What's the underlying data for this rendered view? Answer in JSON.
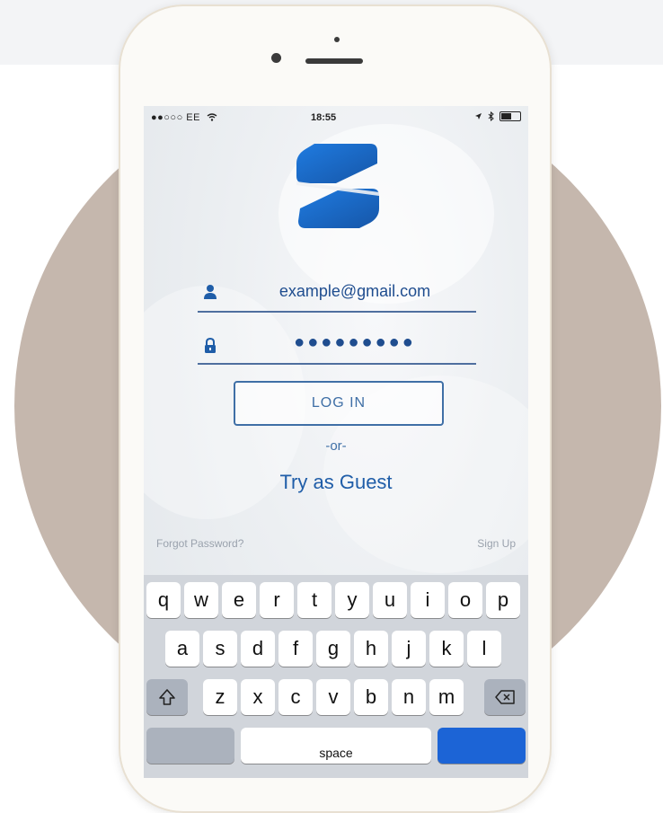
{
  "status_bar": {
    "carrier": "●●○○○ EE",
    "time": "18:55"
  },
  "login": {
    "email_value": "example@gmail.com",
    "password_value": "●●●●●●●●●",
    "login_button": "LOG IN",
    "or_text": "-or-",
    "guest_link": "Try as Guest",
    "forgot_link": "Forgot Password?",
    "signup_link": "Sign Up"
  },
  "icons": {
    "email": "user-icon",
    "password": "lock-icon",
    "shift": "shift-icon",
    "backspace": "backspace-icon",
    "wifi": "wifi-icon",
    "location": "location-arrow-icon",
    "bluetooth": "bluetooth-icon",
    "battery": "battery-icon"
  },
  "keyboard": {
    "row1": [
      "q",
      "w",
      "e",
      "r",
      "t",
      "y",
      "u",
      "i",
      "o",
      "p"
    ],
    "row2": [
      "a",
      "s",
      "d",
      "f",
      "g",
      "h",
      "j",
      "k",
      "l"
    ],
    "row3": [
      "z",
      "x",
      "c",
      "v",
      "b",
      "n",
      "m"
    ],
    "space": "space"
  },
  "colors": {
    "accent": "#1f5da8",
    "keyboard_bg": "#d1d5db",
    "backdrop_circle": "#c5b7ad"
  }
}
